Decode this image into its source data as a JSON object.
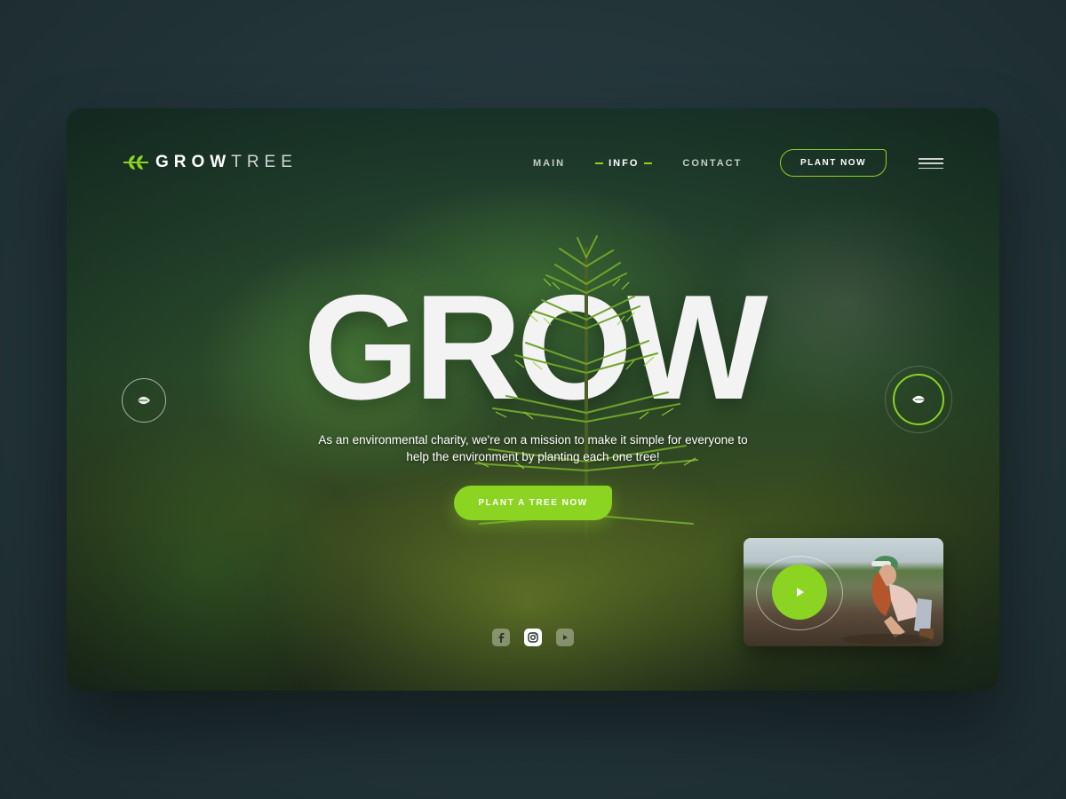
{
  "brand": {
    "logo_bold": "GROW",
    "logo_light": "TREE",
    "accent_color": "#8bd422"
  },
  "nav": {
    "items": [
      {
        "label": "MAIN",
        "active": false
      },
      {
        "label": "INFO",
        "active": true
      },
      {
        "label": "CONTACT",
        "active": false
      }
    ],
    "cta_label": "PLANT NOW",
    "menu_icon": "hamburger-icon"
  },
  "hero": {
    "title": "GROW",
    "subtitle": "As an environmental charity, we're on a mission to make it simple for everyone to help the environment by planting each one tree!",
    "cta_label": "PLANT A TREE NOW",
    "prev_icon": "leaf-icon",
    "next_icon": "leaf-icon"
  },
  "social": {
    "icons": [
      "facebook-icon",
      "instagram-icon",
      "youtube-icon"
    ],
    "active": "instagram-icon"
  },
  "video": {
    "play_icon": "play-icon"
  }
}
